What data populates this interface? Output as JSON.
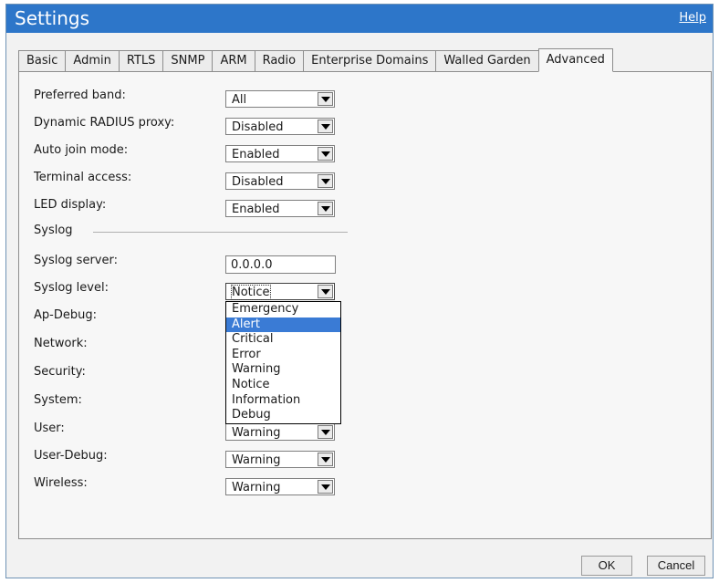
{
  "title": "Settings",
  "help_link": "Help",
  "tabs": [
    "Basic",
    "Admin",
    "RTLS",
    "SNMP",
    "ARM",
    "Radio",
    "Enterprise Domains",
    "Walled Garden",
    "Advanced"
  ],
  "active_tab": "Advanced",
  "general": {
    "preferred_band": {
      "label": "Preferred band:",
      "value": "All"
    },
    "dynamic_radius_proxy": {
      "label": "Dynamic RADIUS proxy:",
      "value": "Disabled"
    },
    "auto_join_mode": {
      "label": "Auto join mode:",
      "value": "Enabled"
    },
    "terminal_access": {
      "label": "Terminal access:",
      "value": "Disabled"
    },
    "led_display": {
      "label": "LED display:",
      "value": "Enabled"
    }
  },
  "syslog": {
    "section_label": "Syslog",
    "server": {
      "label": "Syslog server:",
      "value": "0.0.0.0"
    },
    "level": {
      "label": "Syslog level:",
      "value": "Notice"
    },
    "level_options": [
      "Emergency",
      "Alert",
      "Critical",
      "Error",
      "Warning",
      "Notice",
      "Information",
      "Debug"
    ],
    "highlighted_option": "Alert",
    "categories": {
      "ap_debug": {
        "label": "Ap-Debug:"
      },
      "network": {
        "label": "Network:"
      },
      "security": {
        "label": "Security:"
      },
      "system": {
        "label": "System:"
      },
      "user": {
        "label": "User:",
        "value": "Warning"
      },
      "user_debug": {
        "label": "User-Debug:",
        "value": "Warning"
      },
      "wireless": {
        "label": "Wireless:",
        "value": "Warning"
      }
    }
  },
  "buttons": {
    "ok": "OK",
    "cancel": "Cancel"
  },
  "colors": {
    "titlebar": "#2d76c9",
    "highlight": "#3a7bd5"
  }
}
